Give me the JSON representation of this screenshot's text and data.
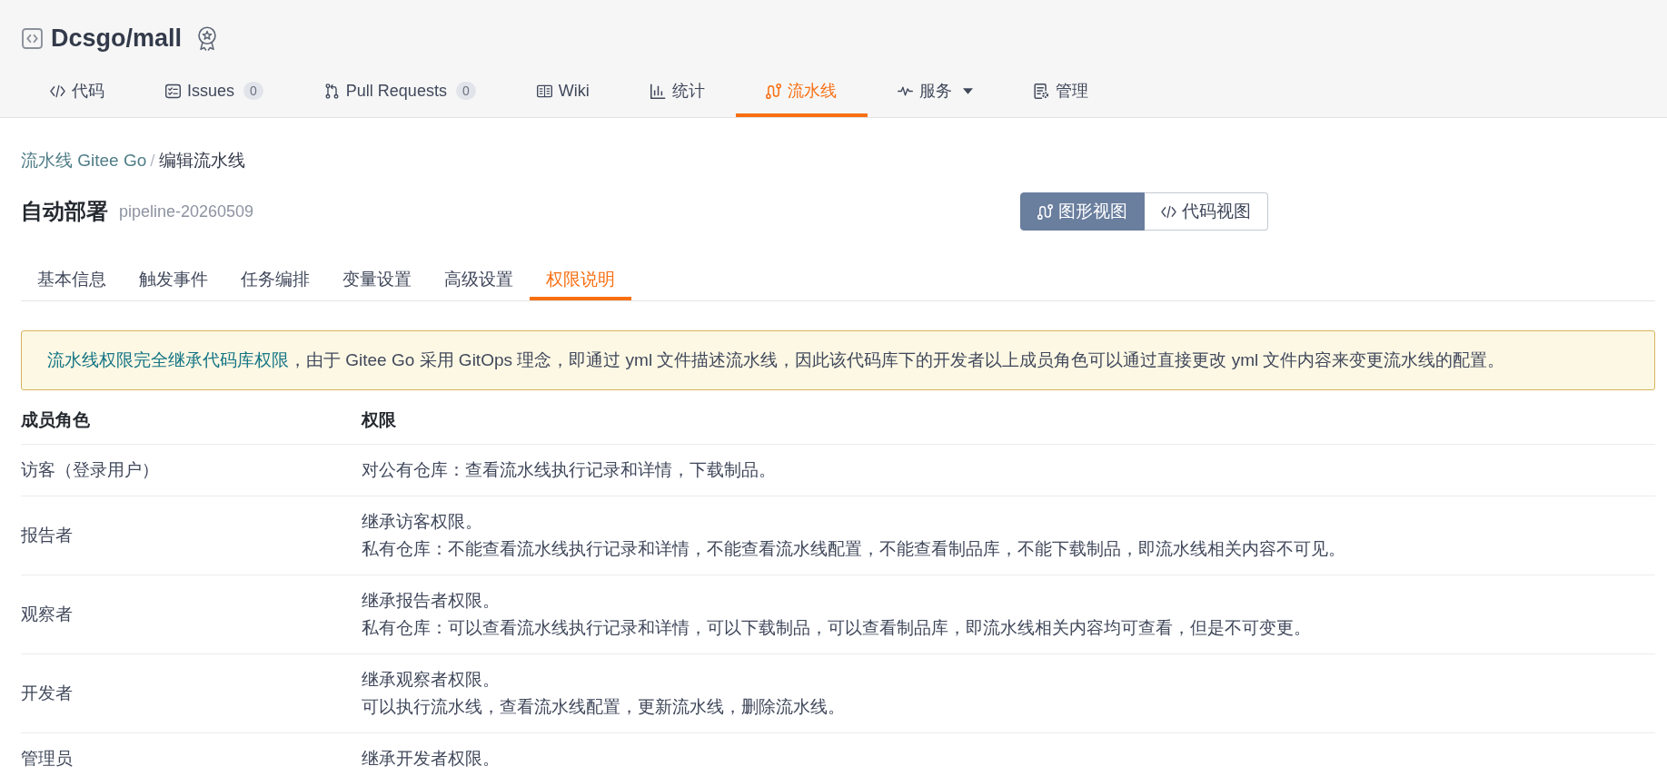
{
  "repo": {
    "title": "Dcsgo/mall"
  },
  "nav_tabs": [
    {
      "label": "代码",
      "kind": "code",
      "selected": false,
      "dropdown": false
    },
    {
      "label": "Issues",
      "kind": "issues",
      "badge": "0",
      "selected": false,
      "dropdown": false
    },
    {
      "label": "Pull Requests",
      "kind": "pulls",
      "badge": "0",
      "selected": false,
      "dropdown": false
    },
    {
      "label": "Wiki",
      "kind": "wiki",
      "selected": false,
      "dropdown": false
    },
    {
      "label": "统计",
      "kind": "stats",
      "selected": false,
      "dropdown": false
    },
    {
      "label": "流水线",
      "kind": "pipeline",
      "selected": true,
      "dropdown": false
    },
    {
      "label": "服务",
      "kind": "services",
      "selected": false,
      "dropdown": true
    },
    {
      "label": "管理",
      "kind": "manage",
      "selected": false,
      "dropdown": false
    }
  ],
  "breadcrumb": {
    "items": [
      {
        "label": "流水线 Gitee Go",
        "kind": "link"
      },
      {
        "label": "编辑流水线",
        "kind": "current"
      }
    ],
    "separator": "/"
  },
  "pipeline": {
    "name": "自动部署",
    "id": "pipeline-20260509"
  },
  "view_toggle": [
    {
      "label": "图形视图",
      "kind": "graph",
      "selected": true
    },
    {
      "label": "代码视图",
      "kind": "code",
      "selected": false
    }
  ],
  "settings_tabs": [
    {
      "label": "基本信息",
      "selected": false
    },
    {
      "label": "触发事件",
      "selected": false
    },
    {
      "label": "任务编排",
      "selected": false
    },
    {
      "label": "变量设置",
      "selected": false
    },
    {
      "label": "高级设置",
      "selected": false
    },
    {
      "label": "权限说明",
      "selected": true
    }
  ],
  "notice": {
    "link": "流水线权限完全继承代码库权限",
    "text": "，由于 Gitee Go 采用 GitOps 理念，即通过 yml 文件描述流水线，因此该代码库下的开发者以上成员角色可以通过直接更改 yml 文件内容来变更流水线的配置。"
  },
  "table": {
    "columns": [
      "成员角色",
      "权限"
    ],
    "rows": [
      {
        "role": "访客（登录用户）",
        "permissions": [
          "对公有仓库：查看流水线执行记录和详情，下载制品。"
        ]
      },
      {
        "role": "报告者",
        "permissions": [
          "继承访客权限。",
          "私有仓库：不能查看流水线执行记录和详情，不能查看流水线配置，不能查看制品库，不能下载制品，即流水线相关内容不可见。"
        ]
      },
      {
        "role": "观察者",
        "permissions": [
          "继承报告者权限。",
          "私有仓库：可以查看流水线执行记录和详情，可以下载制品，可以查看制品库，即流水线相关内容均可查看，但是不可变更。"
        ]
      },
      {
        "role": "开发者",
        "permissions": [
          "继承观察者权限。",
          "可以执行流水线，查看流水线配置，更新流水线，删除流水线。"
        ]
      },
      {
        "role": "管理员",
        "permissions": [
          "继承开发者权限。"
        ]
      }
    ]
  }
}
